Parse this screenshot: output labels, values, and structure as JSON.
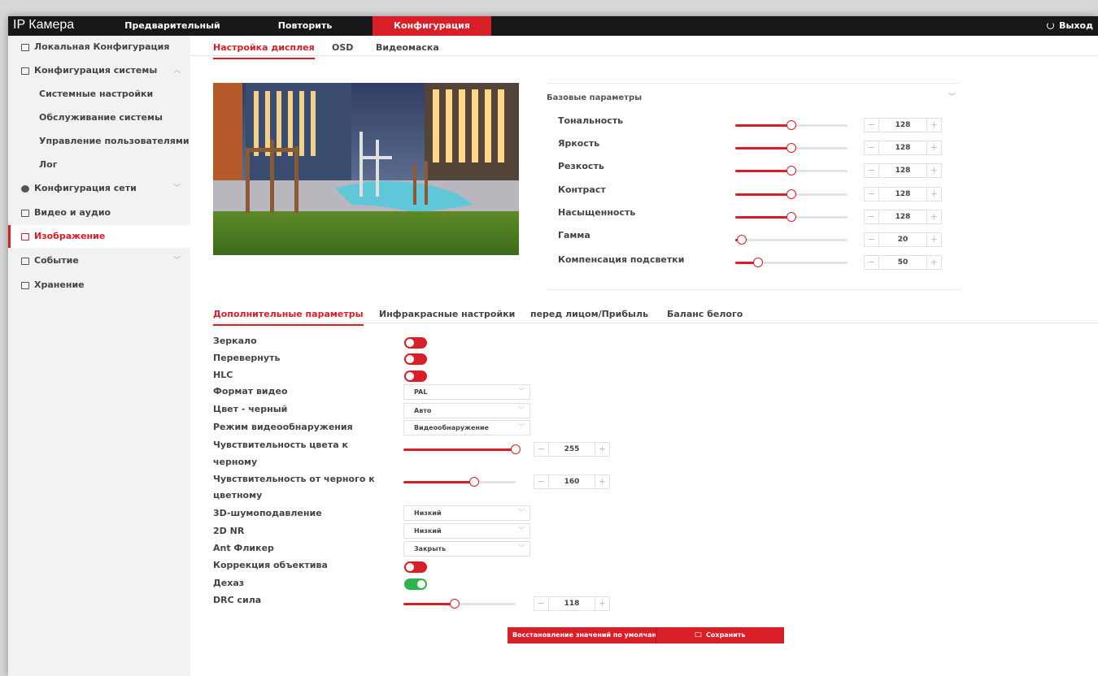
{
  "header": {
    "brand": "IP Камера",
    "nav": [
      {
        "label": "Предварительный просмотр"
      },
      {
        "label": "Повторить"
      },
      {
        "label": "Конфигурация"
      }
    ],
    "logout": "Выход"
  },
  "sidebar": {
    "items": [
      {
        "label": "Локальная Конфигурация",
        "icon": "monitor-icon"
      },
      {
        "label": "Конфигурация системы",
        "icon": "system-icon"
      },
      {
        "label": "Системные настройки"
      },
      {
        "label": "Обслуживание системы"
      },
      {
        "label": "Управление пользователями"
      },
      {
        "label": "Лог"
      },
      {
        "label": "Конфигурация сети",
        "icon": "network-icon"
      },
      {
        "label": "Видео и аудио",
        "icon": "video-audio-icon"
      },
      {
        "label": "Изображение",
        "icon": "image-icon"
      },
      {
        "label": "Событие",
        "icon": "event-icon"
      },
      {
        "label": "Хранение",
        "icon": "storage-icon"
      }
    ]
  },
  "tabs": [
    {
      "label": "Настройка дисплея"
    },
    {
      "label": "OSD"
    },
    {
      "label": "Видеомаска"
    }
  ],
  "basic": {
    "title": "Базовые параметры",
    "params": [
      {
        "label": "Тональность",
        "value": "128",
        "fraction": 0.5
      },
      {
        "label": "Яркость",
        "value": "128",
        "fraction": 0.5
      },
      {
        "label": "Резкость",
        "value": "128",
        "fraction": 0.5
      },
      {
        "label": "Контраст",
        "value": "128",
        "fraction": 0.5
      },
      {
        "label": "Насыщенность",
        "value": "128",
        "fraction": 0.5
      },
      {
        "label": "Гамма",
        "value": "20",
        "fraction": 0.06
      },
      {
        "label": "Компенсация подсветки",
        "value": "50",
        "fraction": 0.2
      }
    ]
  },
  "subtabs": [
    {
      "label": "Дополнительные параметры"
    },
    {
      "label": "Инфракрасные настройки"
    },
    {
      "label": "перед лицом/Прибыль"
    },
    {
      "label": "Баланс белого"
    }
  ],
  "advanced": {
    "mirror": {
      "label": "Зеркало",
      "on": false
    },
    "flip": {
      "label": "Перевернуть",
      "on": false
    },
    "hlc": {
      "label": "HLC",
      "on": false
    },
    "video_format": {
      "label": "Формат видео",
      "value": "PAL"
    },
    "color_black": {
      "label": "Цвет - черный",
      "value": "Авто"
    },
    "detect_mode": {
      "label": "Режим видеообнаружения",
      "value": "Видеообнаружение"
    },
    "sens_color_black": {
      "label_1": "Чувствительность цвета к",
      "label_2": "черному",
      "value": "255",
      "fraction": 1.0
    },
    "sens_black_color": {
      "label_1": "Чувствительность от черного к",
      "label_2": "цветному",
      "value": "160",
      "fraction": 0.63
    },
    "nr3d": {
      "label": "3D-шумоподавление",
      "value": "Низкий"
    },
    "nr2d": {
      "label": "2D NR",
      "value": "Низкий"
    },
    "antiflicker": {
      "label": "Ant Фликер",
      "value": "Закрыть"
    },
    "lens_correction": {
      "label": "Коррекция объектива",
      "on": false
    },
    "dehaze": {
      "label": "Дехаз",
      "on": true
    },
    "drc": {
      "label": "DRC сила",
      "value": "118",
      "fraction": 0.46
    }
  },
  "buttons": {
    "restore": "Восстановление значений по умолчанию",
    "save": "Сохранить"
  },
  "colors": {
    "accent": "#d81e26",
    "topbar": "#18181b",
    "toggle_on": "#2fb24c"
  }
}
